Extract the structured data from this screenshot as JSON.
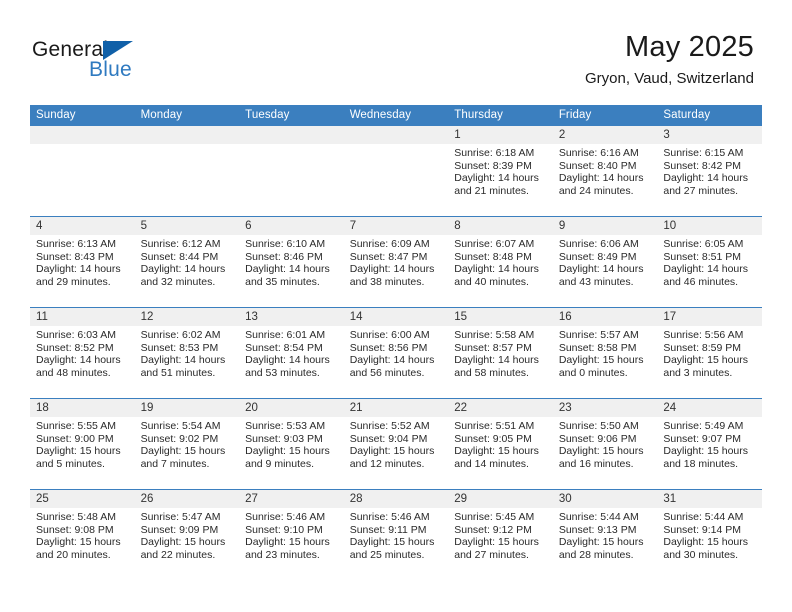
{
  "brand": {
    "name_top": "General",
    "name_bottom": "Blue",
    "accent_color": "#1060a8",
    "blue_text_color": "#2f7ac0",
    "triangle_icon": "triangle-logo-icon"
  },
  "header": {
    "month_title": "May 2025",
    "location": "Gryon, Vaud, Switzerland"
  },
  "theme": {
    "header_band": "#3b7fbf",
    "daynum_band": "#f0f0f0",
    "grid_line": "#3b7fbf",
    "text": "#222222"
  },
  "weekday_headers": [
    "Sunday",
    "Monday",
    "Tuesday",
    "Wednesday",
    "Thursday",
    "Friday",
    "Saturday"
  ],
  "weeks": [
    [
      {
        "day": "",
        "sunrise": "",
        "sunset": "",
        "daylight_1": "",
        "daylight_2": ""
      },
      {
        "day": "",
        "sunrise": "",
        "sunset": "",
        "daylight_1": "",
        "daylight_2": ""
      },
      {
        "day": "",
        "sunrise": "",
        "sunset": "",
        "daylight_1": "",
        "daylight_2": ""
      },
      {
        "day": "",
        "sunrise": "",
        "sunset": "",
        "daylight_1": "",
        "daylight_2": ""
      },
      {
        "day": "1",
        "sunrise": "Sunrise: 6:18 AM",
        "sunset": "Sunset: 8:39 PM",
        "daylight_1": "Daylight: 14 hours",
        "daylight_2": "and 21 minutes."
      },
      {
        "day": "2",
        "sunrise": "Sunrise: 6:16 AM",
        "sunset": "Sunset: 8:40 PM",
        "daylight_1": "Daylight: 14 hours",
        "daylight_2": "and 24 minutes."
      },
      {
        "day": "3",
        "sunrise": "Sunrise: 6:15 AM",
        "sunset": "Sunset: 8:42 PM",
        "daylight_1": "Daylight: 14 hours",
        "daylight_2": "and 27 minutes."
      }
    ],
    [
      {
        "day": "4",
        "sunrise": "Sunrise: 6:13 AM",
        "sunset": "Sunset: 8:43 PM",
        "daylight_1": "Daylight: 14 hours",
        "daylight_2": "and 29 minutes."
      },
      {
        "day": "5",
        "sunrise": "Sunrise: 6:12 AM",
        "sunset": "Sunset: 8:44 PM",
        "daylight_1": "Daylight: 14 hours",
        "daylight_2": "and 32 minutes."
      },
      {
        "day": "6",
        "sunrise": "Sunrise: 6:10 AM",
        "sunset": "Sunset: 8:46 PM",
        "daylight_1": "Daylight: 14 hours",
        "daylight_2": "and 35 minutes."
      },
      {
        "day": "7",
        "sunrise": "Sunrise: 6:09 AM",
        "sunset": "Sunset: 8:47 PM",
        "daylight_1": "Daylight: 14 hours",
        "daylight_2": "and 38 minutes."
      },
      {
        "day": "8",
        "sunrise": "Sunrise: 6:07 AM",
        "sunset": "Sunset: 8:48 PM",
        "daylight_1": "Daylight: 14 hours",
        "daylight_2": "and 40 minutes."
      },
      {
        "day": "9",
        "sunrise": "Sunrise: 6:06 AM",
        "sunset": "Sunset: 8:49 PM",
        "daylight_1": "Daylight: 14 hours",
        "daylight_2": "and 43 minutes."
      },
      {
        "day": "10",
        "sunrise": "Sunrise: 6:05 AM",
        "sunset": "Sunset: 8:51 PM",
        "daylight_1": "Daylight: 14 hours",
        "daylight_2": "and 46 minutes."
      }
    ],
    [
      {
        "day": "11",
        "sunrise": "Sunrise: 6:03 AM",
        "sunset": "Sunset: 8:52 PM",
        "daylight_1": "Daylight: 14 hours",
        "daylight_2": "and 48 minutes."
      },
      {
        "day": "12",
        "sunrise": "Sunrise: 6:02 AM",
        "sunset": "Sunset: 8:53 PM",
        "daylight_1": "Daylight: 14 hours",
        "daylight_2": "and 51 minutes."
      },
      {
        "day": "13",
        "sunrise": "Sunrise: 6:01 AM",
        "sunset": "Sunset: 8:54 PM",
        "daylight_1": "Daylight: 14 hours",
        "daylight_2": "and 53 minutes."
      },
      {
        "day": "14",
        "sunrise": "Sunrise: 6:00 AM",
        "sunset": "Sunset: 8:56 PM",
        "daylight_1": "Daylight: 14 hours",
        "daylight_2": "and 56 minutes."
      },
      {
        "day": "15",
        "sunrise": "Sunrise: 5:58 AM",
        "sunset": "Sunset: 8:57 PM",
        "daylight_1": "Daylight: 14 hours",
        "daylight_2": "and 58 minutes."
      },
      {
        "day": "16",
        "sunrise": "Sunrise: 5:57 AM",
        "sunset": "Sunset: 8:58 PM",
        "daylight_1": "Daylight: 15 hours",
        "daylight_2": "and 0 minutes."
      },
      {
        "day": "17",
        "sunrise": "Sunrise: 5:56 AM",
        "sunset": "Sunset: 8:59 PM",
        "daylight_1": "Daylight: 15 hours",
        "daylight_2": "and 3 minutes."
      }
    ],
    [
      {
        "day": "18",
        "sunrise": "Sunrise: 5:55 AM",
        "sunset": "Sunset: 9:00 PM",
        "daylight_1": "Daylight: 15 hours",
        "daylight_2": "and 5 minutes."
      },
      {
        "day": "19",
        "sunrise": "Sunrise: 5:54 AM",
        "sunset": "Sunset: 9:02 PM",
        "daylight_1": "Daylight: 15 hours",
        "daylight_2": "and 7 minutes."
      },
      {
        "day": "20",
        "sunrise": "Sunrise: 5:53 AM",
        "sunset": "Sunset: 9:03 PM",
        "daylight_1": "Daylight: 15 hours",
        "daylight_2": "and 9 minutes."
      },
      {
        "day": "21",
        "sunrise": "Sunrise: 5:52 AM",
        "sunset": "Sunset: 9:04 PM",
        "daylight_1": "Daylight: 15 hours",
        "daylight_2": "and 12 minutes."
      },
      {
        "day": "22",
        "sunrise": "Sunrise: 5:51 AM",
        "sunset": "Sunset: 9:05 PM",
        "daylight_1": "Daylight: 15 hours",
        "daylight_2": "and 14 minutes."
      },
      {
        "day": "23",
        "sunrise": "Sunrise: 5:50 AM",
        "sunset": "Sunset: 9:06 PM",
        "daylight_1": "Daylight: 15 hours",
        "daylight_2": "and 16 minutes."
      },
      {
        "day": "24",
        "sunrise": "Sunrise: 5:49 AM",
        "sunset": "Sunset: 9:07 PM",
        "daylight_1": "Daylight: 15 hours",
        "daylight_2": "and 18 minutes."
      }
    ],
    [
      {
        "day": "25",
        "sunrise": "Sunrise: 5:48 AM",
        "sunset": "Sunset: 9:08 PM",
        "daylight_1": "Daylight: 15 hours",
        "daylight_2": "and 20 minutes."
      },
      {
        "day": "26",
        "sunrise": "Sunrise: 5:47 AM",
        "sunset": "Sunset: 9:09 PM",
        "daylight_1": "Daylight: 15 hours",
        "daylight_2": "and 22 minutes."
      },
      {
        "day": "27",
        "sunrise": "Sunrise: 5:46 AM",
        "sunset": "Sunset: 9:10 PM",
        "daylight_1": "Daylight: 15 hours",
        "daylight_2": "and 23 minutes."
      },
      {
        "day": "28",
        "sunrise": "Sunrise: 5:46 AM",
        "sunset": "Sunset: 9:11 PM",
        "daylight_1": "Daylight: 15 hours",
        "daylight_2": "and 25 minutes."
      },
      {
        "day": "29",
        "sunrise": "Sunrise: 5:45 AM",
        "sunset": "Sunset: 9:12 PM",
        "daylight_1": "Daylight: 15 hours",
        "daylight_2": "and 27 minutes."
      },
      {
        "day": "30",
        "sunrise": "Sunrise: 5:44 AM",
        "sunset": "Sunset: 9:13 PM",
        "daylight_1": "Daylight: 15 hours",
        "daylight_2": "and 28 minutes."
      },
      {
        "day": "31",
        "sunrise": "Sunrise: 5:44 AM",
        "sunset": "Sunset: 9:14 PM",
        "daylight_1": "Daylight: 15 hours",
        "daylight_2": "and 30 minutes."
      }
    ]
  ]
}
